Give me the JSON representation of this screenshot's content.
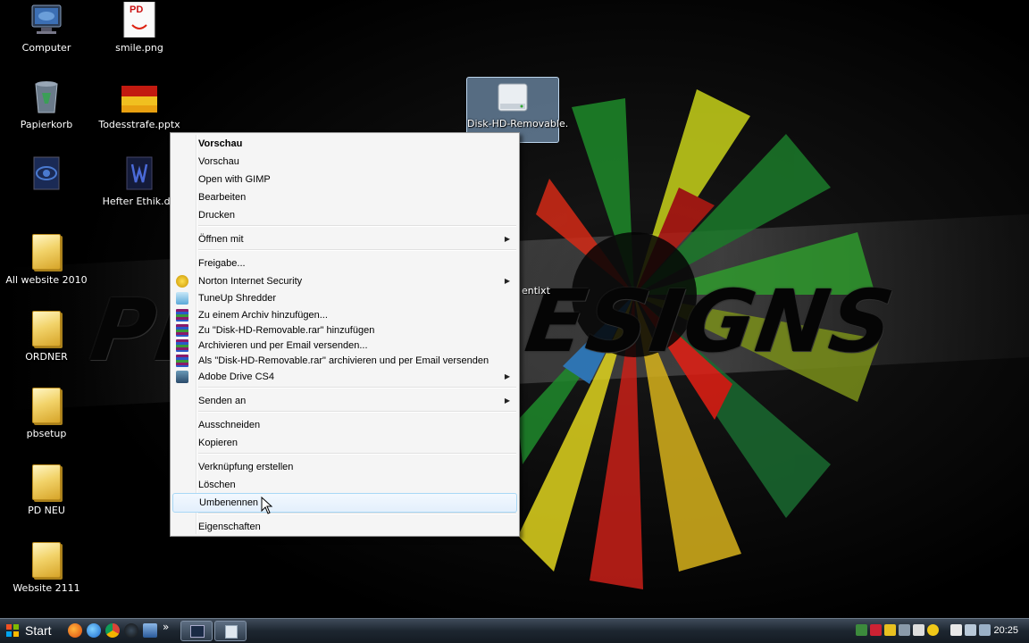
{
  "desktop": {
    "wallpaper_text_left": "PH",
    "wallpaper_text_right": "ESIGNS",
    "icons": [
      {
        "label": "Computer",
        "icon": "computer-icon"
      },
      {
        "label": "smile.png",
        "icon": "image-file-icon"
      },
      {
        "label": "Papierkorb",
        "icon": "recycle-bin-icon"
      },
      {
        "label": "Todesstrafe.pptx",
        "icon": "powerpoint-file-icon"
      },
      {
        "label": "",
        "icon": "shortcut-icon"
      },
      {
        "label": "Hefter Ethik.do",
        "icon": "word-file-icon"
      },
      {
        "label": "All website 2010",
        "icon": "folder-icon"
      },
      {
        "label": "ORDNER",
        "icon": "folder-icon"
      },
      {
        "label": "pbsetup",
        "icon": "folder-icon"
      },
      {
        "label": "PD NEU",
        "icon": "folder-icon"
      },
      {
        "label": "Website 2111",
        "icon": "folder-icon"
      },
      {
        "label": "Disk-HD-Removable.",
        "icon": "removable-disk-icon"
      }
    ],
    "smile_badge": "PD",
    "partial_label": "entixt"
  },
  "context_menu": {
    "items": [
      {
        "label": "Vorschau",
        "bold": true
      },
      {
        "label": "Vorschau"
      },
      {
        "label": "Open with GIMP"
      },
      {
        "label": "Bearbeiten"
      },
      {
        "label": "Drucken"
      },
      {
        "label": "Öffnen mit",
        "submenu": true
      },
      {
        "label": "Freigabe..."
      },
      {
        "label": "Norton Internet Security",
        "submenu": true,
        "icon": "norton-icon"
      },
      {
        "label": "TuneUp Shredder",
        "icon": "shredder-icon"
      },
      {
        "label": "Zu einem Archiv hinzufügen...",
        "icon": "winrar-icon"
      },
      {
        "label": "Zu \"Disk-HD-Removable.rar\" hinzufügen",
        "icon": "winrar-icon"
      },
      {
        "label": "Archivieren und per Email versenden...",
        "icon": "winrar-icon"
      },
      {
        "label": "Als \"Disk-HD-Removable.rar\" archivieren und per Email versenden",
        "icon": "winrar-icon"
      },
      {
        "label": "Adobe Drive CS4",
        "submenu": true,
        "icon": "adobe-drive-icon"
      },
      {
        "label": "Senden an",
        "submenu": true
      },
      {
        "label": "Ausschneiden"
      },
      {
        "label": "Kopieren"
      },
      {
        "label": "Verknüpfung erstellen"
      },
      {
        "label": "Löschen"
      },
      {
        "label": "Umbenennen",
        "hover": true
      },
      {
        "label": "Eigenschaften"
      }
    ],
    "submenu_arrow": "▶"
  },
  "taskbar": {
    "start_label": "Start",
    "chevron": "»",
    "clock": "20:25"
  },
  "colors": {
    "menu_bg": "#f5f5f5",
    "hover_border": "#a8d8f6",
    "taskbar": "#1d2630"
  }
}
